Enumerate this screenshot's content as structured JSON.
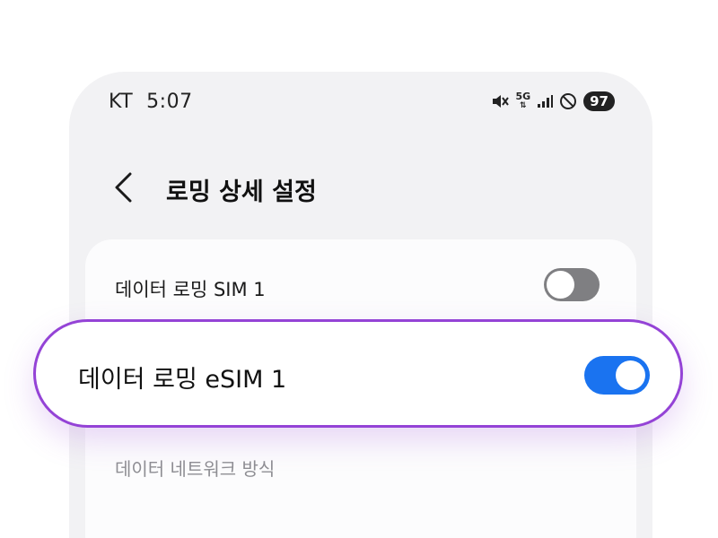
{
  "status_bar": {
    "carrier": "KT",
    "time": "5:07",
    "network": "5G",
    "battery": "97"
  },
  "header": {
    "title": "로밍 상세 설정"
  },
  "settings": {
    "data_roaming_sim1": {
      "label": "데이터 로밍 SIM 1",
      "enabled": false
    },
    "data_roaming_esim1": {
      "label": "데이터 로밍 eSIM 1",
      "enabled": true
    },
    "data_network_mode": {
      "label": "데이터 네트워크 방식"
    }
  },
  "colors": {
    "highlight_border": "#9443d6",
    "toggle_on": "#1a73f0",
    "toggle_off": "#7f7f82"
  }
}
